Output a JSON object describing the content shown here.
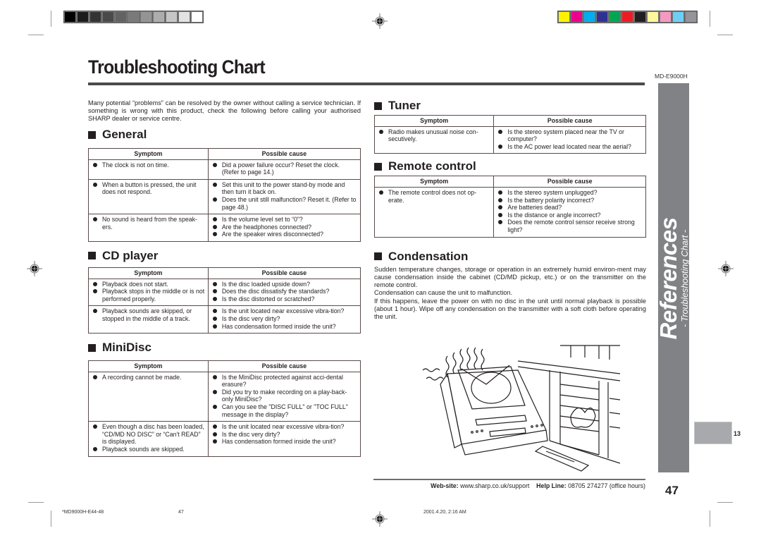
{
  "header": {
    "title": "Troubleshooting Chart",
    "model": "MD-E9000H"
  },
  "intro": "Many potential “problems” can be resolved by the owner without calling a service technician. If something is wrong with this product, check the following before calling your authorised SHARP dealer or service centre.",
  "table_headers": {
    "symptom": "Symptom",
    "cause": "Possible cause"
  },
  "sections": {
    "general": {
      "title": "General",
      "rows": [
        {
          "symptoms": [
            "The clock is not on time."
          ],
          "causes": [
            "Did a power failure occur? Reset the clock. (Refer to page 14.)"
          ]
        },
        {
          "symptoms": [
            "When a button is pressed, the unit does not respond."
          ],
          "causes": [
            "Set this unit to the power stand-by mode and then turn it back on.",
            "Does the unit still malfunction? Reset it. (Refer to page 48.)"
          ]
        },
        {
          "symptoms": [
            "No sound is heard from the speak-ers."
          ],
          "causes": [
            "Is the volume level set to “0”?",
            "Are the headphones connected?",
            "Are the speaker wires disconnected?"
          ]
        }
      ]
    },
    "cd_player": {
      "title": "CD player",
      "rows": [
        {
          "symptoms": [
            "Playback does not start.",
            "Playback stops in the middle or is not performed properly."
          ],
          "causes": [
            "Is the disc loaded upside down?",
            "Does the disc dissatisfy the standards?",
            "Is the disc distorted or scratched?"
          ]
        },
        {
          "symptoms": [
            "Playback sounds are skipped, or stopped in the middle of a track."
          ],
          "causes": [
            "Is the unit located near excessive vibra-tion?",
            "Is the disc very dirty?",
            "Has condensation formed inside the unit?"
          ]
        }
      ]
    },
    "minidisc": {
      "title": "MiniDisc",
      "rows": [
        {
          "symptoms": [
            "A recording cannot be made."
          ],
          "causes": [
            "Is the MiniDisc protected against acci-dental erasure?",
            "Did you try to make recording on a play-back-only MiniDisc?",
            "Can you see the \"DISC FULL\" or \"TOC FULL\" message in the display?"
          ]
        },
        {
          "symptoms": [
            "Even though a disc has been loaded, “CD/MD NO DISC” or “Can't READ” is displayed.",
            "Playback sounds are skipped."
          ],
          "causes": [
            "Is the unit located near excessive vibra-tion?",
            "Is the disc very dirty?",
            "Has condensation formed inside the unit?"
          ]
        }
      ]
    },
    "tuner": {
      "title": "Tuner",
      "rows": [
        {
          "symptoms": [
            "Radio makes unusual noise con-secutively."
          ],
          "causes": [
            "Is the stereo system placed near the TV or computer?",
            "Is the AC power lead located near the aerial?"
          ]
        }
      ]
    },
    "remote": {
      "title": "Remote control",
      "rows": [
        {
          "symptoms": [
            "The remote control does not op-erate."
          ],
          "causes": [
            "Is the stereo system unplugged?",
            "Is the battery polarity incorrect?",
            "Are batteries dead?",
            "Is the distance or angle incorrect?",
            "Does the remote control sensor receive strong light?"
          ]
        }
      ]
    },
    "condensation": {
      "title": "Condensation",
      "paragraphs": [
        "Sudden temperature changes, storage or operation in an extremely humid environ-ment may cause condensation inside the cabinet (CD/MD pickup, etc.) or on the transmitter on the remote control.",
        "Condensation can cause the unit to malfunction.",
        "If this happens, leave the power on with no disc in the unit until normal playback is possible (about 1 hour). Wipe off any condensation on the transmitter with a soft cloth before operating the unit."
      ]
    }
  },
  "illustration": {
    "icon": "stereo-near-fireplace-illustration"
  },
  "side_tab": {
    "main": "References",
    "sub": "- Troubleshooting Chart -",
    "page_tab_number": "13"
  },
  "footer": {
    "website_label": "Web-site:",
    "website": "www.sharp.co.uk/support",
    "helpline_label": "Help Line:",
    "helpline": "08705 274277 (office hours)",
    "page_number": "47"
  },
  "print_info": {
    "file": "*MD9000H-E44-48",
    "page": "47",
    "date": "2001.4.20, 2:16 AM"
  },
  "color_bars": {
    "gray": [
      "#000000",
      "#1c1c1c",
      "#333333",
      "#4a4a4a",
      "#626262",
      "#7a7a7a",
      "#949494",
      "#adadad",
      "#c6c6c6",
      "#e2e2e2",
      "#ffffff"
    ],
    "color": [
      "#fff200",
      "#ec008c",
      "#00aeef",
      "#2e3192",
      "#00a651",
      "#ed1c24",
      "#231f20",
      "#fff799",
      "#f49ac1",
      "#6dcff6",
      "#939598"
    ]
  }
}
